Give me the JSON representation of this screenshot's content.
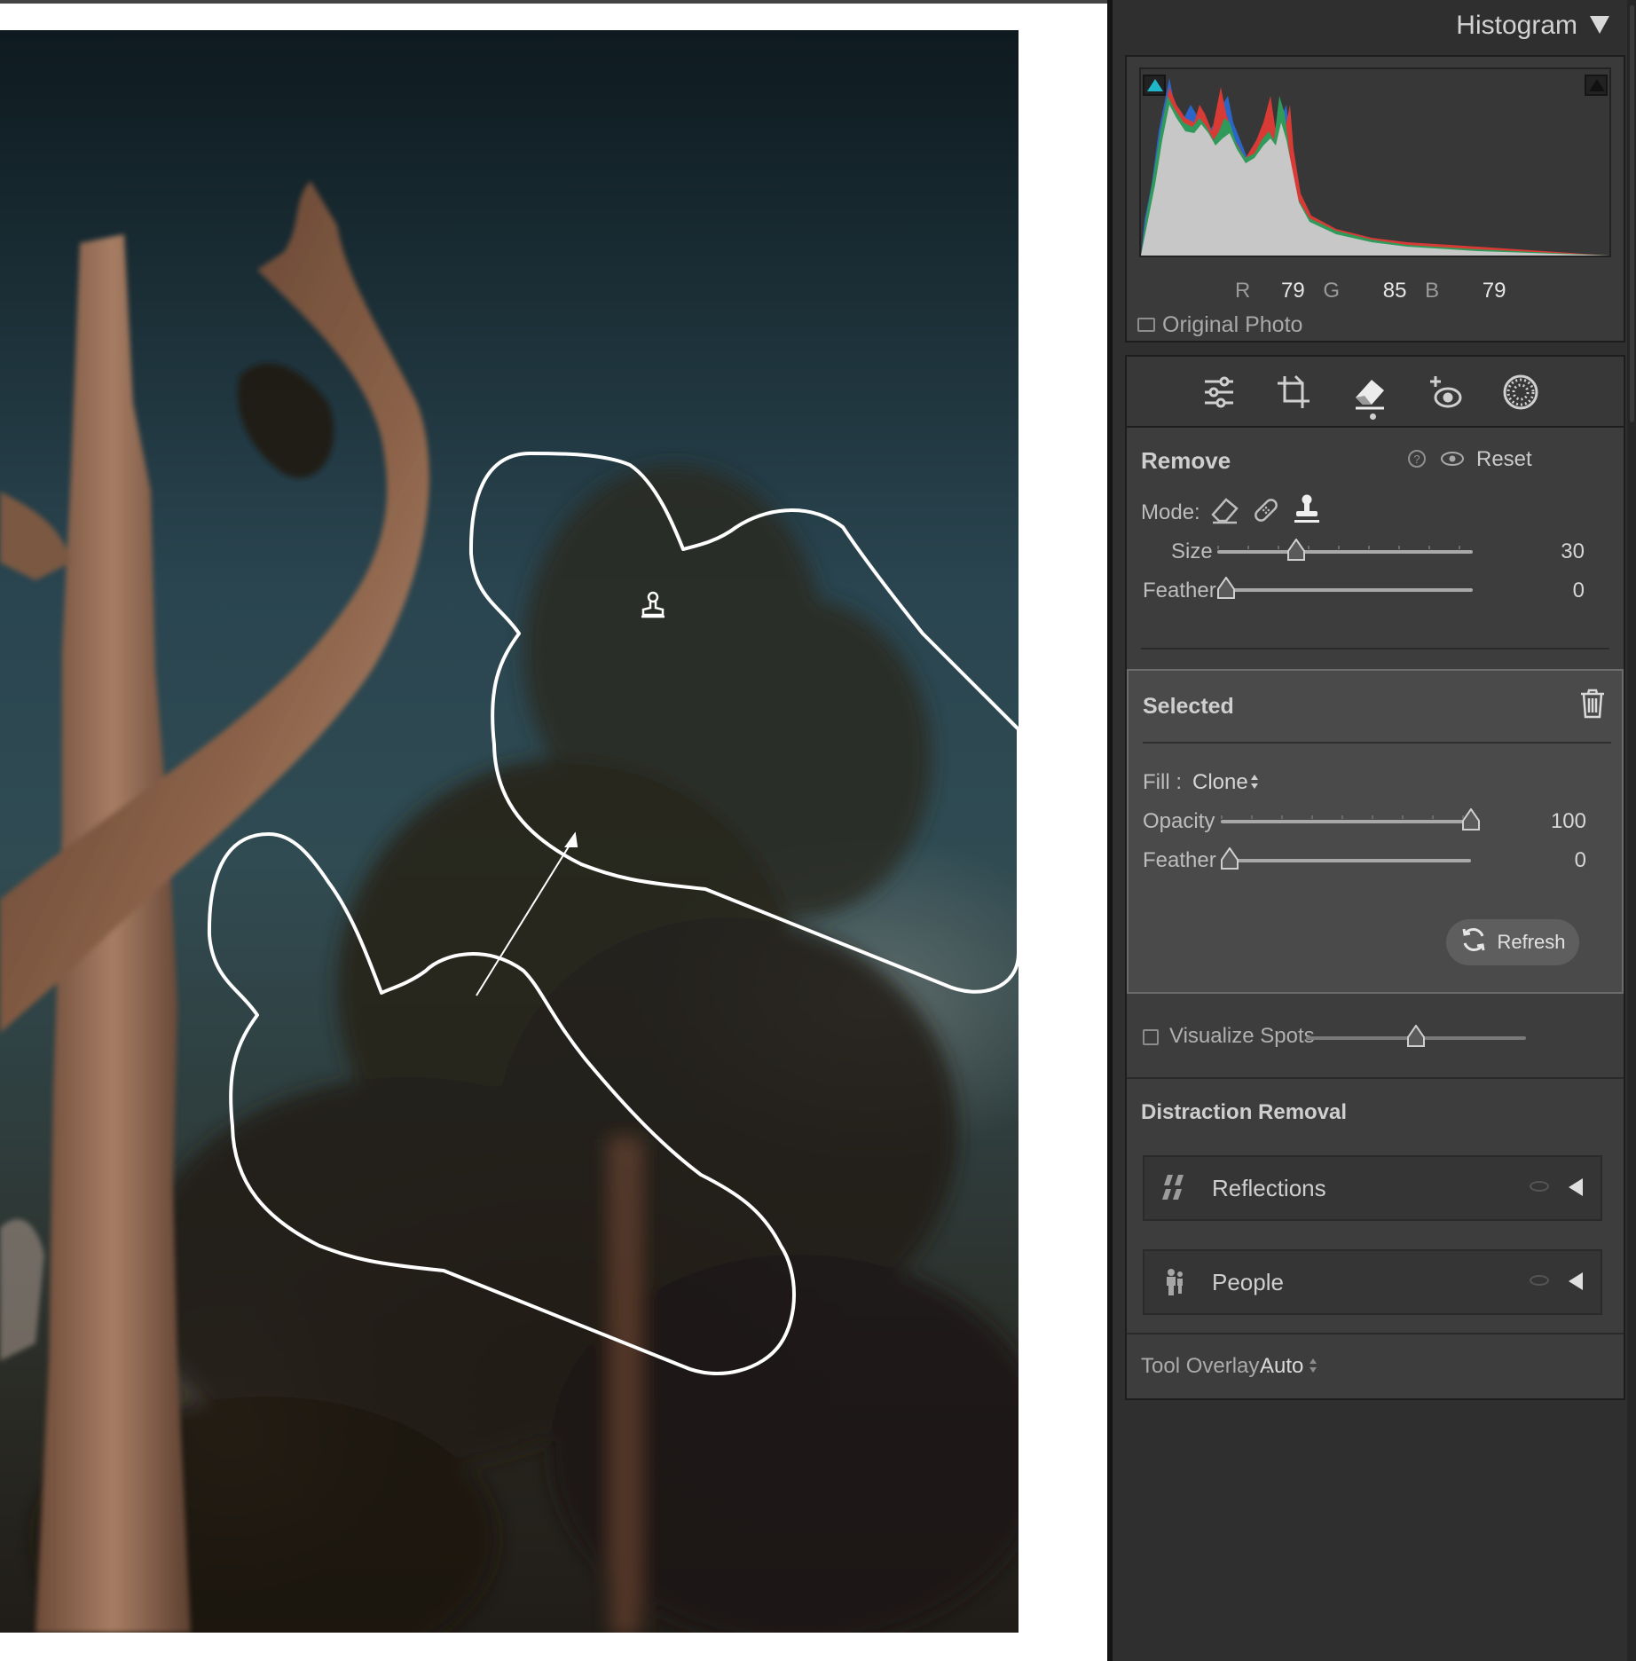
{
  "histogram": {
    "title": "Histogram",
    "r_label": "R",
    "r_value": "79",
    "g_label": "G",
    "g_value": "85",
    "b_label": "B",
    "b_value": "79",
    "original_photo_label": "Original Photo",
    "shadow_clip_color": "#20b8c8"
  },
  "tools": [
    "edit-sliders-icon",
    "crop-icon",
    "remove-eraser-icon",
    "red-eye-icon",
    "masking-icon"
  ],
  "remove": {
    "title": "Remove",
    "reset_label": "Reset",
    "mode_label": "Mode:",
    "mode_icons": [
      "eraser-icon",
      "bandage-icon",
      "clone-stamp-icon"
    ],
    "size_label": "Size",
    "size_value": "30",
    "size_fraction": 0.31,
    "feather_label": "Feather",
    "feather_value": "0",
    "feather_fraction": 0.0
  },
  "selected": {
    "title": "Selected",
    "fill_label": "Fill :",
    "fill_value": "Clone",
    "opacity_label": "Opacity",
    "opacity_value": "100",
    "opacity_fraction": 1.0,
    "feather_label": "Feather",
    "feather_value": "0",
    "feather_fraction": 0.0,
    "refresh_label": "Refresh"
  },
  "visualize_spots": {
    "label": "Visualize Spots",
    "checked": false,
    "fraction": 0.5
  },
  "distraction_removal": {
    "title": "Distraction Removal",
    "items": [
      {
        "label": "Reflections",
        "icon": "reflections-icon"
      },
      {
        "label": "People",
        "icon": "people-icon"
      }
    ]
  },
  "tool_overlay": {
    "label": "Tool Overlay :",
    "value": "Auto"
  },
  "colors": {
    "panel_bg": "#2f2f2f",
    "selected_bg": "#4a4a4a",
    "outline": "#ffffff"
  }
}
